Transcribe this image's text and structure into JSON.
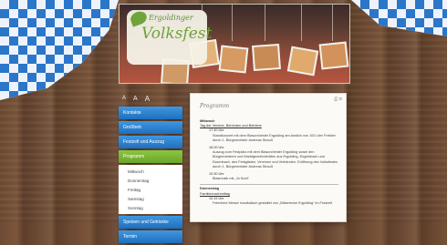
{
  "logo": {
    "top_text": "Ergoldinger",
    "main_text": "Volksfest"
  },
  "toolbar": {
    "items": [
      "A",
      "A",
      "A"
    ]
  },
  "sidebar": {
    "items": [
      {
        "label": "Kontakte"
      },
      {
        "label": "Großbetr."
      },
      {
        "label": "Festzelt und Auszug"
      },
      {
        "label": "Programm"
      },
      {
        "label": "Speisen und Getränke"
      },
      {
        "label": "Termin"
      }
    ],
    "subitems": [
      "Mittwoch",
      "Donnerstag",
      "Freitag",
      "Samstag",
      "Sonntag"
    ]
  },
  "content": {
    "icons": "⎙ ✉",
    "title": "Programm",
    "wed": {
      "day": "Mittwoch",
      "heading": "Tag der Vereine, Behörden und Betriebe",
      "e1_time": "17.30 Uhr",
      "e1_text": "Standkonzert mit dem Blasorchester Ergolding am Anstich von 100 Liter Freibier durch 1. Bürgermeister Andreas Strauß",
      "e2_time": "18.00 Uhr",
      "e2_text": "Auszug zum Festplatz mit dem Blasorchester Ergolding sowie den Bürgermeistern und Marktgemeinderäten aus Ergolding, Engelsbach und Essenbach, den Festgästen, Vereinen und Verbänden. Eröffnung des Volksfestes durch 1. Bürgermeister Andreas Strauß",
      "e3_time": "19.30 Uhr",
      "e3_text": "Blasmusik mit „Jo Nuni“"
    },
    "thu": {
      "day": "Donnerstag",
      "heading": "Familiennachmittag",
      "e1_time": "10.15 Uhr",
      "e1_text": "Feierliche Messe musikalisch gestaltet von „Bläserecke Ergolding“ im Festzelt"
    }
  }
}
